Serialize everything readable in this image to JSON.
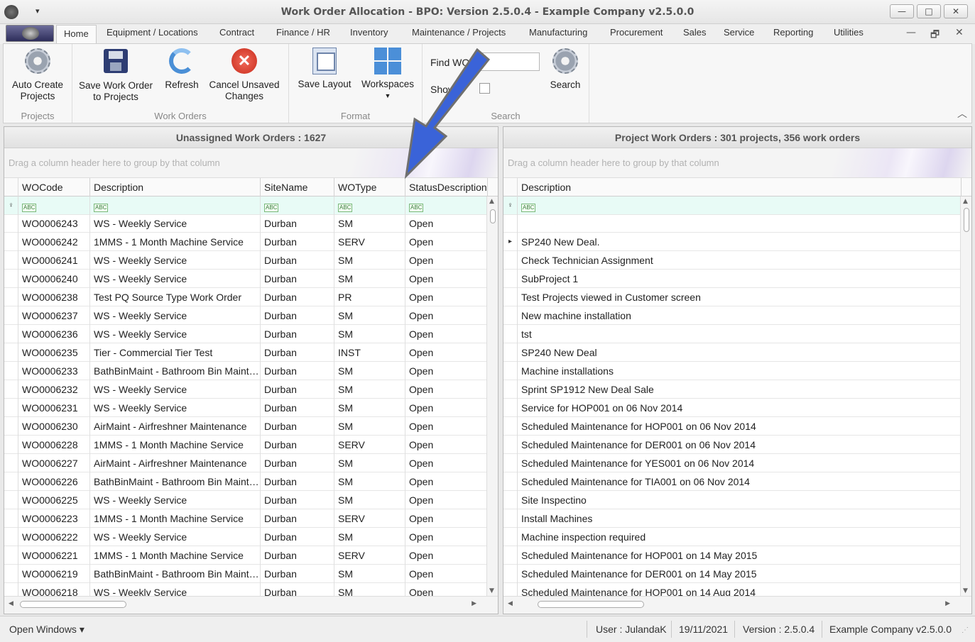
{
  "window": {
    "title": "Work Order Allocation - BPO: Version 2.5.0.4 - Example Company v2.5.0.0",
    "qat_glyph": "▾",
    "minimize": "—",
    "maximize": "□",
    "close": "✕"
  },
  "menu": {
    "tabs": [
      "Home",
      "Equipment / Locations",
      "Contract",
      "Finance / HR",
      "Inventory",
      "Maintenance / Projects",
      "Manufacturing",
      "Procurement",
      "Sales",
      "Service",
      "Reporting",
      "Utilities"
    ],
    "active_tab": "Home",
    "mdi_minimize": "—",
    "mdi_restore": "🗗",
    "mdi_close": "✕"
  },
  "ribbon": {
    "groups": {
      "projects": "Projects",
      "work_orders": "Work Orders",
      "format": "Format",
      "search": "Search"
    },
    "buttons": {
      "auto_create_projects": "Auto Create Projects",
      "save_wo_to_projects": "Save Work Order to Projects",
      "refresh": "Refresh",
      "cancel_unsaved": "Cancel Unsaved Changes",
      "save_layout": "Save Layout",
      "workspaces": "Workspaces",
      "search": "Search"
    },
    "find_label": "Find WO/s",
    "find_value": "",
    "show_label": "Show",
    "collapse_glyph": "︿"
  },
  "left_panel": {
    "header": "Unassigned Work Orders : 1627",
    "group_hint": "Drag a column header here to group by that column",
    "columns": [
      "WOCode",
      "Description",
      "SiteName",
      "WOType",
      "StatusDescription"
    ],
    "filter_glyph": "♀",
    "rows": [
      [
        "WO0006243",
        "WS - Weekly Service",
        "Durban",
        "SM",
        "Open"
      ],
      [
        "WO0006242",
        "1MMS - 1 Month Machine Service",
        "Durban",
        "SERV",
        "Open"
      ],
      [
        "WO0006241",
        "WS - Weekly Service",
        "Durban",
        "SM",
        "Open"
      ],
      [
        "WO0006240",
        "WS - Weekly Service",
        "Durban",
        "SM",
        "Open"
      ],
      [
        "WO0006238",
        "Test PQ Source Type Work Order",
        "Durban",
        "PR",
        "Open"
      ],
      [
        "WO0006237",
        "WS - Weekly Service",
        "Durban",
        "SM",
        "Open"
      ],
      [
        "WO0006236",
        "WS - Weekly Service",
        "Durban",
        "SM",
        "Open"
      ],
      [
        "WO0006235",
        "Tier - Commercial Tier Test",
        "Durban",
        "INST",
        "Open"
      ],
      [
        "WO0006233",
        "BathBinMaint - Bathroom Bin Mainte...",
        "Durban",
        "SM",
        "Open"
      ],
      [
        "WO0006232",
        "WS - Weekly Service",
        "Durban",
        "SM",
        "Open"
      ],
      [
        "WO0006231",
        "WS - Weekly Service",
        "Durban",
        "SM",
        "Open"
      ],
      [
        "WO0006230",
        "AirMaint - Airfreshner Maintenance",
        "Durban",
        "SM",
        "Open"
      ],
      [
        "WO0006228",
        "1MMS - 1 Month Machine Service",
        "Durban",
        "SERV",
        "Open"
      ],
      [
        "WO0006227",
        "AirMaint - Airfreshner Maintenance",
        "Durban",
        "SM",
        "Open"
      ],
      [
        "WO0006226",
        "BathBinMaint - Bathroom Bin Mainte...",
        "Durban",
        "SM",
        "Open"
      ],
      [
        "WO0006225",
        "WS - Weekly Service",
        "Durban",
        "SM",
        "Open"
      ],
      [
        "WO0006223",
        "1MMS - 1 Month Machine Service",
        "Durban",
        "SERV",
        "Open"
      ],
      [
        "WO0006222",
        "WS - Weekly Service",
        "Durban",
        "SM",
        "Open"
      ],
      [
        "WO0006221",
        "1MMS - 1 Month Machine Service",
        "Durban",
        "SERV",
        "Open"
      ],
      [
        "WO0006219",
        "BathBinMaint - Bathroom Bin Mainte...",
        "Durban",
        "SM",
        "Open"
      ],
      [
        "WO0006218",
        "WS - Weekly Service",
        "Durban",
        "SM",
        "Open"
      ]
    ]
  },
  "right_panel": {
    "header": "Project Work Orders : 301 projects, 356 work orders",
    "group_hint": "Drag a column header here to group by that column",
    "columns": [
      "Description"
    ],
    "filter_glyph": "♀",
    "current_row_glyph": "▸",
    "rows": [
      "",
      "SP240 New Deal.",
      "Check Technician Assignment",
      "SubProject 1",
      "Test Projects viewed in Customer screen",
      "New machine installation",
      "tst",
      "SP240 New Deal",
      "Machine installations",
      "Sprint SP1912 New Deal Sale",
      "Service for HOP001 on 06 Nov 2014",
      "Scheduled Maintenance for HOP001 on 06 Nov 2014",
      "Scheduled Maintenance for DER001 on 06 Nov 2014",
      "Scheduled Maintenance for YES001 on 06 Nov 2014",
      "Scheduled Maintenance for TIA001 on 06 Nov 2014",
      "Site Inspectino",
      "Install Machines",
      "Machine inspection required",
      "Scheduled Maintenance for HOP001 on 14 May 2015",
      "Scheduled Maintenance for DER001 on 14 May 2015",
      "Scheduled Maintenance for HOP001 on 14 Aug 2014"
    ]
  },
  "statusbar": {
    "open_windows": "Open Windows ▾",
    "user": "User : JulandaK",
    "date": "19/11/2021",
    "version": "Version : 2.5.0.4",
    "company": "Example Company v2.5.0.0"
  },
  "annotation": {
    "arrow_color": "#3a63d8"
  }
}
